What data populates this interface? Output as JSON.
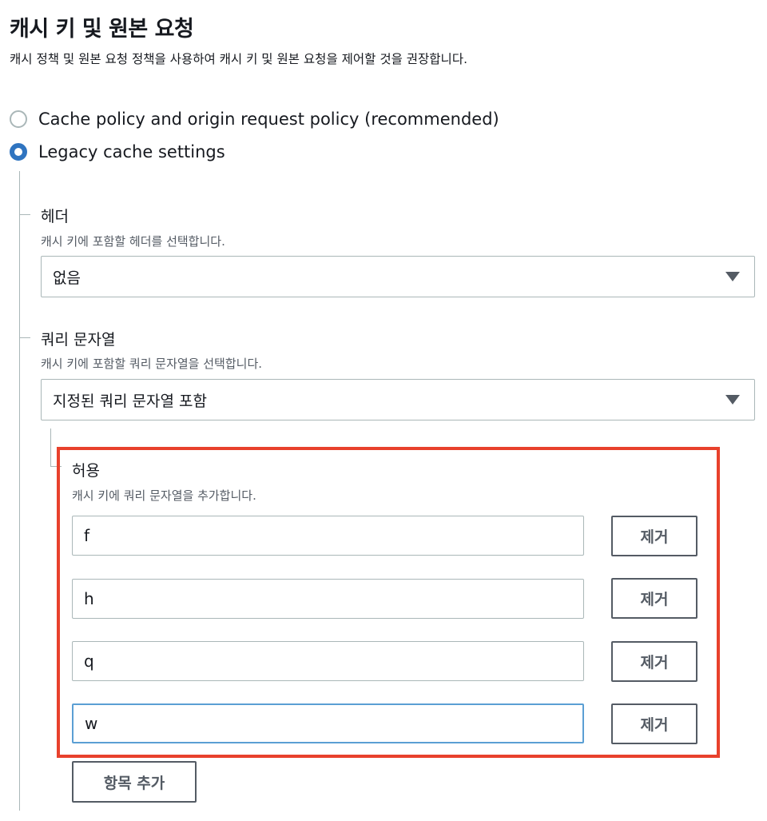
{
  "section": {
    "title": "캐시 키 및 원본 요청",
    "description": "캐시 정책 및 원본 요청 정책을 사용하여 캐시 키 및 원본 요청을 제어할 것을 권장합니다."
  },
  "radio_options": [
    {
      "label": "Cache policy and origin request policy (recommended)",
      "checked": false
    },
    {
      "label": "Legacy cache settings",
      "checked": true
    }
  ],
  "headers": {
    "label": "헤더",
    "description": "캐시 키에 포함할 헤더를 선택합니다.",
    "selected": "없음"
  },
  "query_strings": {
    "label": "쿼리 문자열",
    "description": "캐시 키에 포함할 쿼리 문자열을 선택합니다.",
    "selected": "지정된 쿼리 문자열 포함"
  },
  "allow": {
    "label": "허용",
    "description": "캐시 키에 쿼리 문자열을 추가합니다.",
    "items": [
      {
        "value": "f",
        "remove_label": "제거"
      },
      {
        "value": "h",
        "remove_label": "제거"
      },
      {
        "value": "q",
        "remove_label": "제거"
      },
      {
        "value": "w",
        "remove_label": "제거"
      }
    ],
    "add_label": "항목 추가"
  },
  "colors": {
    "accent": "#2f74c0",
    "highlight": "#e8412c",
    "focus": "#5b9fd4"
  }
}
